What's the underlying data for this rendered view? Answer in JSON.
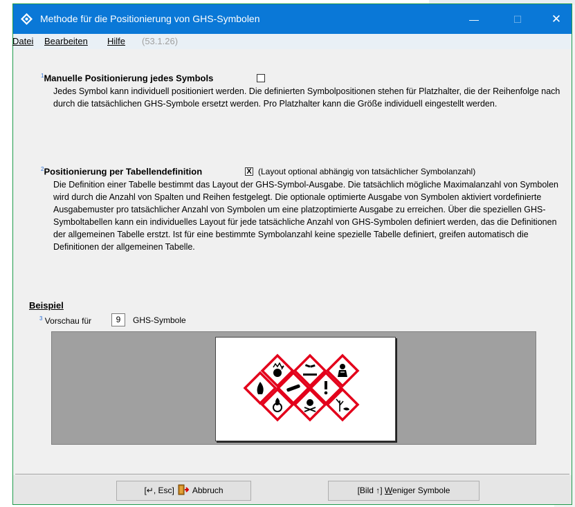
{
  "window": {
    "title": "Methode für die Positionierung von GHS-Symbolen",
    "controls": {
      "minimize": "—",
      "maximize": "☐",
      "close": "✕"
    }
  },
  "menu": {
    "datei": "Datei",
    "bearbeiten": "Bearbeiten",
    "hilfe": "Hilfe",
    "version": "(53.1.26)"
  },
  "section1": {
    "index": "1",
    "heading": "Manuelle Positionierung jedes Symbols",
    "checked": false,
    "description": "Jedes Symbol kann individuell positioniert werden. Die definierten Symbolpositionen stehen für Platzhalter, die der Reihenfolge nach durch die tatsächlichen GHS-Symbole ersetzt werden. Pro Platzhalter kann die Größe individuell eingestellt werden."
  },
  "section2": {
    "index": "2",
    "heading": "Positionierung per Tabellendefinition",
    "checked": true,
    "check_mark": "X",
    "note": "(Layout optional abhängig von tatsächlicher Symbolanzahl)",
    "description": "Die Definition einer Tabelle bestimmt das Layout der GHS-Symbol-Ausgabe. Die tatsächlich mögliche Maximalanzahl von Symbolen wird durch die Anzahl von Spalten und Reihen festgelegt. Die optionale optimierte Ausgabe von Symbolen aktiviert vordefinierte Ausgabemuster pro tatsächlicher Anzahl von Symbolen um eine platzoptimierte Ausgabe zu erreichen. Über die speziellen GHS-Symboltabellen kann ein individuelles Layout für jede tatsächliche Anzahl von GHS-Symbolen definiert werden, das die Definitionen der allgemeinen Tabelle erstzt. Ist für eine bestimmte Symbolanzahl keine spezielle Tabelle definiert, greifen automatisch die Definitionen der allgemeinen Tabelle."
  },
  "example": {
    "heading": "Beispiel",
    "index": "3",
    "preview_label": "Vorschau für",
    "count": "9",
    "unit_label": "GHS-Symbole",
    "symbols": [
      "exploding-bomb",
      "flame",
      "corrosion",
      "health-hazard",
      "gas-cylinder",
      "exclamation-mark",
      "flame-over-circle",
      "skull-crossbones",
      "environment"
    ]
  },
  "buttons": {
    "cancel": {
      "keys": "[↵, Esc]",
      "label": "Abbruch"
    },
    "fewer": {
      "keys": "[Bild ↑]",
      "label_underlined": "W",
      "label_rest": "eniger Symbole"
    }
  },
  "colors": {
    "titlebar": "#0a78d7",
    "window_border": "#1e9b4a",
    "ghs_red": "#e3001b",
    "preview_bg": "#a0a0a0"
  }
}
